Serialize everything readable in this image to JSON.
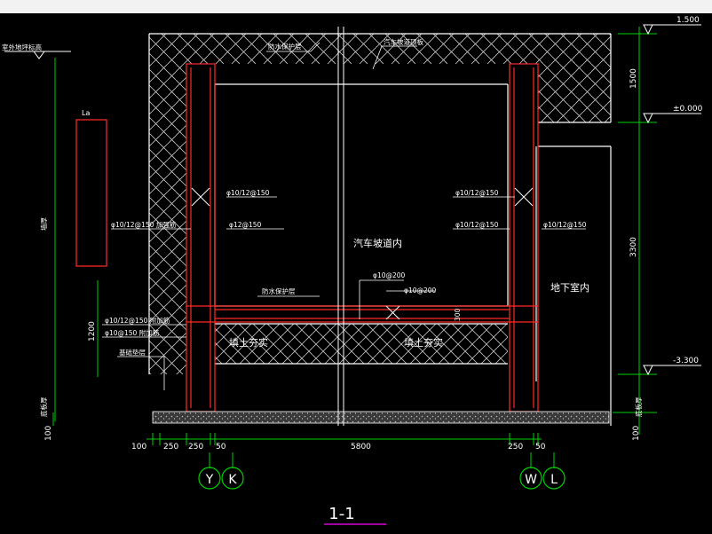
{
  "drawing": {
    "section_title": "1-1",
    "axis_bubbles": [
      "Y",
      "K",
      "W",
      "L"
    ],
    "elevations": {
      "top": "1.500",
      "ground": "±0.000",
      "bottom": "-3.300"
    },
    "vertical_dims": {
      "top": "1500",
      "middle": "3300",
      "left_lower": "1200",
      "left_base": "100",
      "right_base": "100"
    },
    "horizontal_dims": [
      "100",
      "250",
      "250",
      "50",
      "5800",
      "250",
      "50"
    ],
    "rebar_labels": {
      "left_upper": "φ10/12@150",
      "left_outer": "φ10/12@150 加强筋",
      "left_inner": "φ12@150",
      "right_upper": "φ10/12@150",
      "right_inner": "φ10/12@150",
      "right_outer": "φ10/12@150",
      "slab_a": "φ10@200",
      "slab_b": "φ10@200",
      "slab_height": "300",
      "left_lower_a": "φ10/12@150 附加筋",
      "left_lower_b": "φ10@150 附加筋",
      "foundation_note": "基础垫层"
    },
    "room_labels": {
      "ramp": "汽车坡道内",
      "basement": "地下室内",
      "fill_left": "填土夯实",
      "fill_right": "填土夯实"
    },
    "notes": {
      "left_level": "室外地坪标高",
      "roof_left": "防水保护层",
      "roof_right": "汽车坡道顶板",
      "internal_note": "防水保护层",
      "left_vertical": "墙厚",
      "left_base_label": "底板厚",
      "right_base_label": "底板厚",
      "detail_tag": "La"
    }
  }
}
